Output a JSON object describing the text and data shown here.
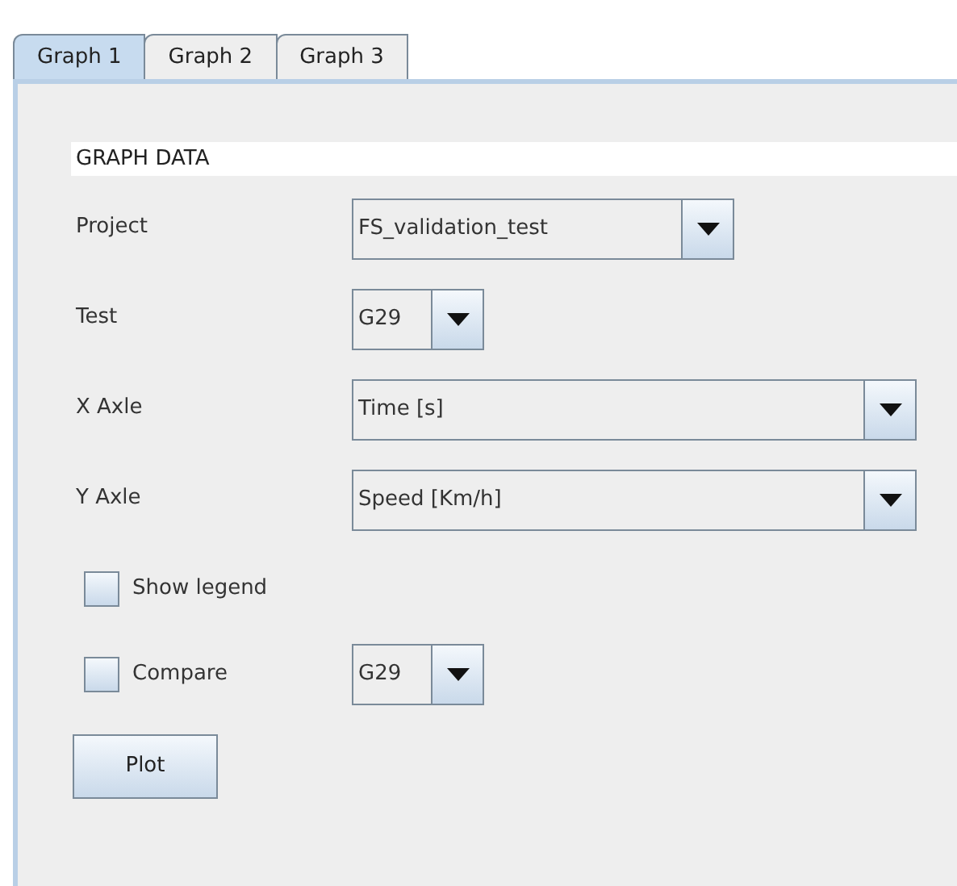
{
  "tabs": [
    {
      "label": "Graph 1",
      "selected": true
    },
    {
      "label": "Graph 2",
      "selected": false
    },
    {
      "label": "Graph 3",
      "selected": false
    }
  ],
  "section_title": "GRAPH DATA",
  "fields": [
    {
      "label": "Project",
      "value": "FS_validation_test"
    },
    {
      "label": "Test",
      "value": "G29"
    },
    {
      "label": "X Axle",
      "value": "Time [s]"
    },
    {
      "label": "Y Axle",
      "value": "Speed [Km/h]"
    }
  ],
  "show_legend": {
    "label": "Show legend",
    "checked": false
  },
  "compare": {
    "label": "Compare",
    "checked": false,
    "value": "G29"
  },
  "plot_button": "Plot"
}
